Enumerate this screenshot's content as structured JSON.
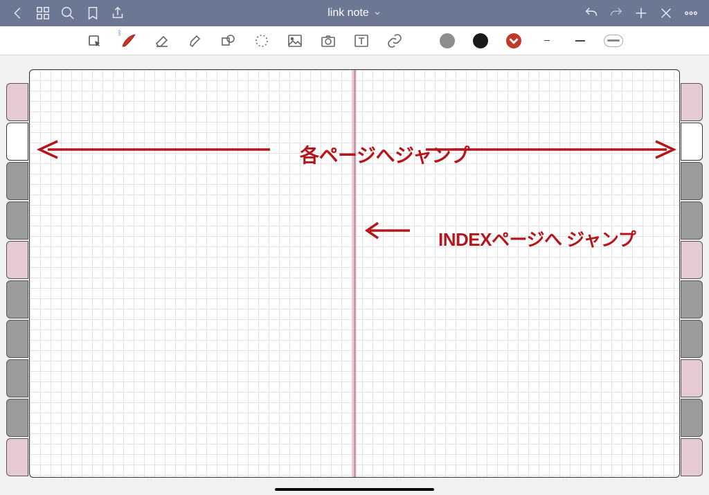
{
  "document_title": "link note",
  "handwriting": {
    "line1": "各ページへジャンプ",
    "line2": "INDEXページへ ジャンプ"
  },
  "colors": {
    "grey": "#8d8d8d",
    "black": "#1a1a1a",
    "red_solid": "#c0392b"
  },
  "tabs_left": [
    {
      "active": false,
      "dark": false
    },
    {
      "active": true,
      "dark": false
    },
    {
      "active": false,
      "dark": true
    },
    {
      "active": false,
      "dark": true
    },
    {
      "active": false,
      "dark": false
    },
    {
      "active": false,
      "dark": true
    },
    {
      "active": false,
      "dark": true
    },
    {
      "active": false,
      "dark": true
    },
    {
      "active": false,
      "dark": true
    },
    {
      "active": false,
      "dark": false
    }
  ],
  "tabs_right": [
    {
      "active": false,
      "dark": false
    },
    {
      "active": true,
      "dark": false
    },
    {
      "active": false,
      "dark": true
    },
    {
      "active": false,
      "dark": true
    },
    {
      "active": false,
      "dark": false
    },
    {
      "active": false,
      "dark": true
    },
    {
      "active": false,
      "dark": true
    },
    {
      "active": false,
      "dark": false
    },
    {
      "active": false,
      "dark": true
    },
    {
      "active": false,
      "dark": false
    }
  ]
}
